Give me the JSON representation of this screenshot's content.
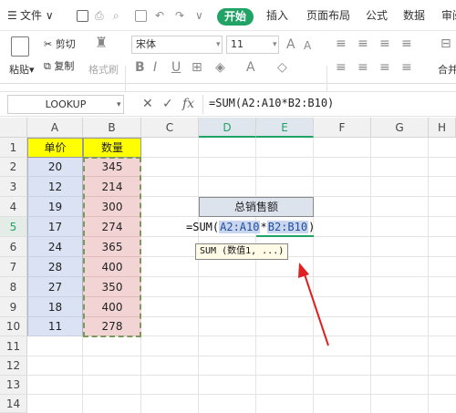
{
  "menu": {
    "file_label": "文件",
    "tabs": [
      "开始",
      "插入",
      "页面布局",
      "公式",
      "数据",
      "审阅"
    ]
  },
  "ribbon": {
    "paste_label": "粘贴",
    "cut_label": "剪切",
    "copy_label": "复制",
    "format_painter_label": "格式刷",
    "font_name": "宋体",
    "font_size": "11",
    "merge_label": "合并"
  },
  "formula_bar": {
    "name_box": "LOOKUP",
    "fx_label": "fx",
    "formula": "=SUM(A2:A10*B2:B10)"
  },
  "columns": [
    "A",
    "B",
    "C",
    "D",
    "E",
    "F",
    "G",
    "H"
  ],
  "rows": [
    "1",
    "2",
    "3",
    "4",
    "5",
    "6",
    "7",
    "8",
    "9",
    "10",
    "11",
    "12",
    "13",
    "14"
  ],
  "table": {
    "header_a": "单价",
    "header_b": "数量",
    "col_a": [
      "20",
      "12",
      "19",
      "17",
      "24",
      "28",
      "27",
      "18",
      "11"
    ],
    "col_b": [
      "345",
      "214",
      "300",
      "274",
      "365",
      "400",
      "350",
      "400",
      "278"
    ]
  },
  "summary": {
    "label": "总销售额",
    "formula_prefix": "=SUM(",
    "ref_a": "A2:A10",
    "op": "*",
    "ref_b": "B2:B10",
    "formula_suffix": ")",
    "tooltip": "SUM (数值1, ...)"
  },
  "colors": {
    "accent": "#21a366",
    "header_yellow": "#ffff00",
    "col_a_fill": "#dae2f3",
    "col_b_fill": "#f2d4d4",
    "arrow": "#e02020"
  }
}
